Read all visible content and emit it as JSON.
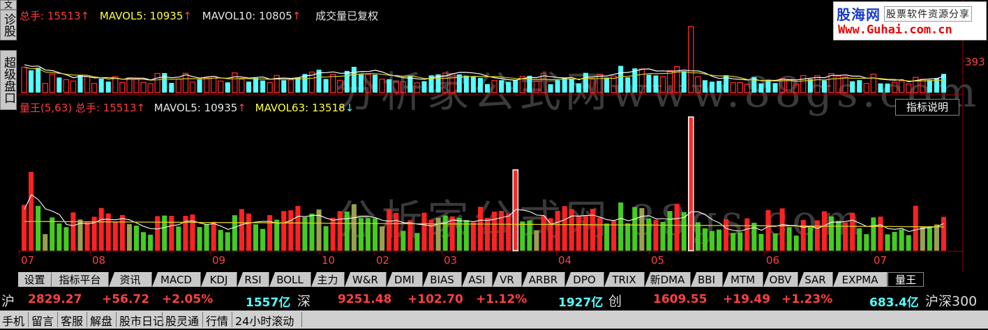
{
  "side_tabs": {
    "diagnose": "诊股",
    "super": "超级盘口",
    "top_partial": "文"
  },
  "volume_header": {
    "total": "总手: 15513",
    "mavol5": "MAVOL5: 10935",
    "mavol10": "MAVOL10: 10805",
    "note": "成交量已复权",
    "axis_value": "393"
  },
  "indicator_header": {
    "name": "量王(5,63)",
    "total": "总手: 15513",
    "mavol5": "MAVOL5: 10935",
    "mavol63": "MAVOL63: 13518",
    "explain_button": "指标说明"
  },
  "watermark": {
    "text": "分析家公式网www.88gs.com",
    "text2": "分析家公式网   88gs.com"
  },
  "logo": {
    "name": "股海网",
    "slogan": "股票软件资源分享",
    "url": "Www.Guhai.com.cn"
  },
  "date_axis": [
    "07",
    "08",
    "09",
    "10",
    "02",
    "03",
    "04",
    "05",
    "06",
    "07"
  ],
  "tabs": [
    "设置",
    "指标平台",
    "资讯",
    "MACD",
    "KDJ",
    "RSI",
    "BOLL",
    "主力",
    "W&R",
    "DMI",
    "BIAS",
    "ASI",
    "VR",
    "ARBR",
    "DPO",
    "TRIX",
    "新DMA",
    "BBI",
    "MTM",
    "OBV",
    "SAR",
    "EXPMA",
    "量王"
  ],
  "active_tab": "量王",
  "markets": [
    {
      "name": "沪",
      "price": "2829.27",
      "change": "+56.72",
      "pct": "+2.05%",
      "amount": "1557亿"
    },
    {
      "name": "深",
      "price": "9251.48",
      "change": "+102.70",
      "pct": "+1.12%",
      "amount": "1927亿"
    },
    {
      "name": "创",
      "price": "1609.55",
      "change": "+19.49",
      "pct": "+1.23%",
      "amount": "683.4亿"
    }
  ],
  "market_extra": "沪深300",
  "bottom_links": [
    "手机",
    "留言",
    "客服",
    "解盘",
    "股市日记",
    "股灵通",
    "行情",
    "24小时滚动"
  ],
  "colors": {
    "up": "#ff2a2a",
    "down": "#55ffff",
    "green": "#44cc22",
    "ma_white": "#ffffff",
    "ma_yellow": "#e0d020"
  }
}
